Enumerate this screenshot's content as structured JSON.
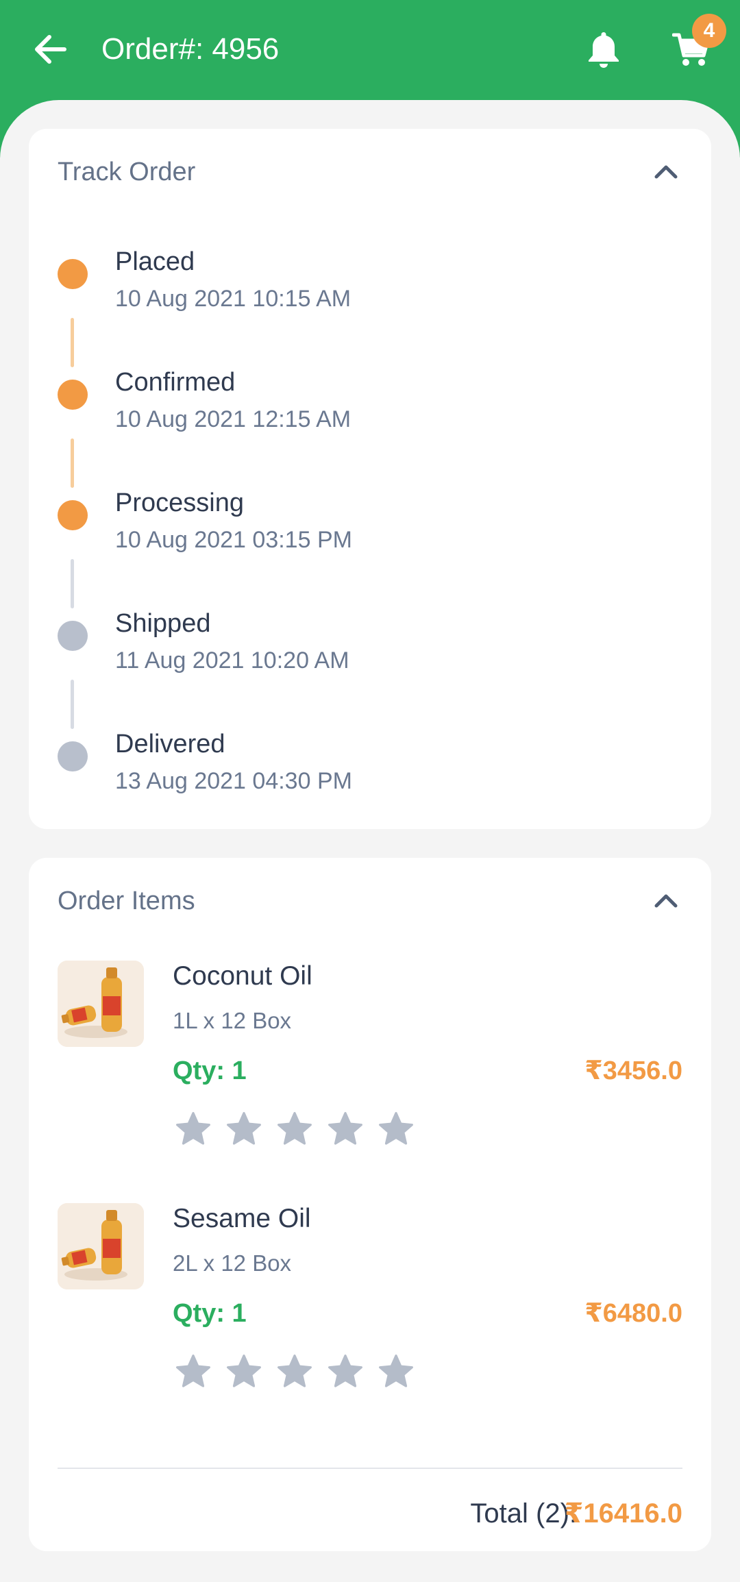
{
  "header": {
    "title": "Order#: 4956",
    "cart_count": "4"
  },
  "colors": {
    "brand": "#2bae5f",
    "accent": "#f29a44",
    "inactive": "#b8bfcc"
  },
  "track": {
    "heading": "Track Order",
    "steps": [
      {
        "name": "Placed",
        "date": "10 Aug 2021 10:15 AM",
        "done": true
      },
      {
        "name": "Confirmed",
        "date": "10 Aug 2021 12:15 AM",
        "done": true
      },
      {
        "name": "Processing",
        "date": "10 Aug 2021 03:15 PM",
        "done": true
      },
      {
        "name": "Shipped",
        "date": "11 Aug 2021 10:20 AM",
        "done": false
      },
      {
        "name": "Delivered",
        "date": "13 Aug 2021 04:30 PM",
        "done": false
      }
    ]
  },
  "items": {
    "heading": "Order Items",
    "list": [
      {
        "name": "Coconut Oil",
        "pack": "1L x 12 Box",
        "qty": "Qty: 1",
        "price": "₹3456.0",
        "rating": 0
      },
      {
        "name": "Sesame Oil",
        "pack": "2L x 12 Box",
        "qty": "Qty: 1",
        "price": "₹6480.0",
        "rating": 0
      }
    ],
    "total_label": "Total (2):",
    "total_value": "₹16416.0"
  }
}
